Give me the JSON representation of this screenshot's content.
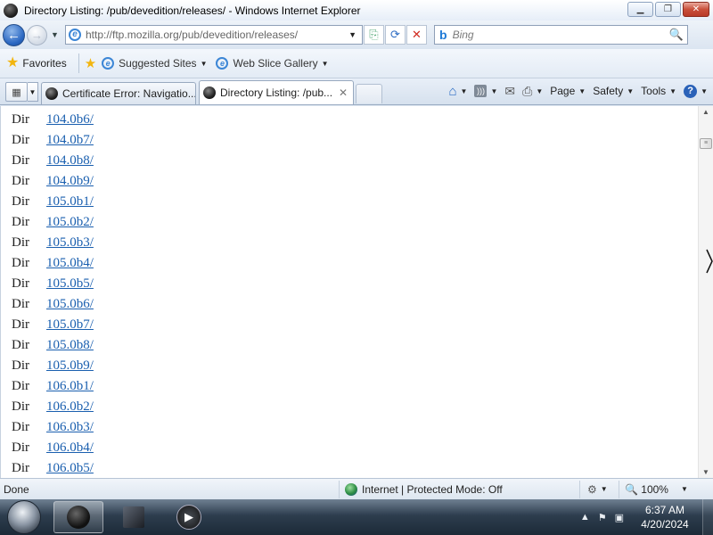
{
  "window": {
    "title": "Directory Listing: /pub/devedition/releases/ - Windows Internet Explorer",
    "minimize_glyph": "▁",
    "maximize_glyph": "❐",
    "close_glyph": "✕"
  },
  "navigation": {
    "back_glyph": "←",
    "forward_glyph": "→",
    "address_url": "http://ftp.mozilla.org/pub/devedition/releases/",
    "search_placeholder": "Bing",
    "search_icon": "search-icon",
    "search_glyph": "🔍"
  },
  "favorites_bar": {
    "favorites_label": "Favorites",
    "links": [
      {
        "label": "Suggested Sites"
      },
      {
        "label": "Web Slice Gallery"
      }
    ]
  },
  "tabs": [
    {
      "label": "Certificate Error: Navigatio...",
      "active": false
    },
    {
      "label": "Directory Listing: /pub...",
      "active": true
    }
  ],
  "command_bar": {
    "page_label": "Page",
    "safety_label": "Safety",
    "tools_label": "Tools"
  },
  "listing": {
    "rows": [
      {
        "type": "Dir",
        "name": "104.0b6/"
      },
      {
        "type": "Dir",
        "name": "104.0b7/"
      },
      {
        "type": "Dir",
        "name": "104.0b8/"
      },
      {
        "type": "Dir",
        "name": "104.0b9/"
      },
      {
        "type": "Dir",
        "name": "105.0b1/"
      },
      {
        "type": "Dir",
        "name": "105.0b2/"
      },
      {
        "type": "Dir",
        "name": "105.0b3/"
      },
      {
        "type": "Dir",
        "name": "105.0b4/"
      },
      {
        "type": "Dir",
        "name": "105.0b5/"
      },
      {
        "type": "Dir",
        "name": "105.0b6/"
      },
      {
        "type": "Dir",
        "name": "105.0b7/"
      },
      {
        "type": "Dir",
        "name": "105.0b8/"
      },
      {
        "type": "Dir",
        "name": "105.0b9/"
      },
      {
        "type": "Dir",
        "name": "106.0b1/"
      },
      {
        "type": "Dir",
        "name": "106.0b2/"
      },
      {
        "type": "Dir",
        "name": "106.0b3/"
      },
      {
        "type": "Dir",
        "name": "106.0b4/"
      },
      {
        "type": "Dir",
        "name": "106.0b5/"
      }
    ]
  },
  "status_bar": {
    "status_text": "Done",
    "zone_text": "Internet | Protected Mode: Off",
    "zoom_text": "100%"
  },
  "taskbar": {
    "time": "6:37 AM",
    "date": "4/20/2024"
  },
  "colors": {
    "link": "#1a5faf",
    "close_button": "#c9503b",
    "taskbar": "#2d3d4e"
  }
}
